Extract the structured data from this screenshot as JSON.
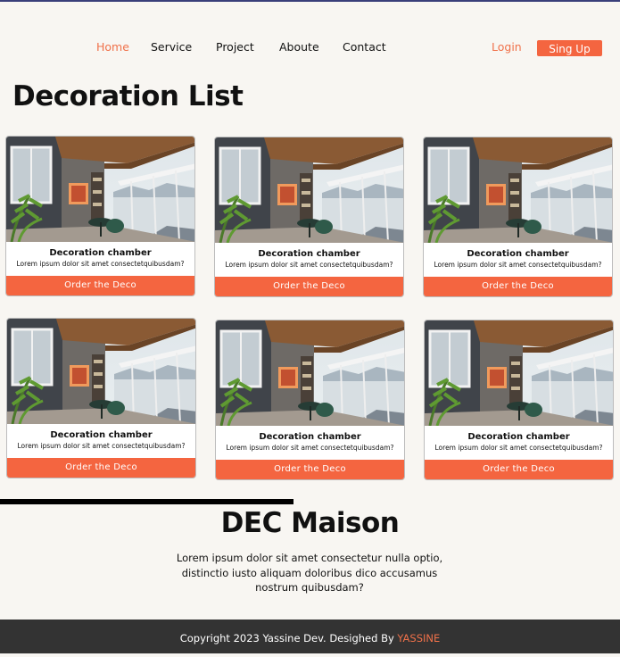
{
  "nav": {
    "items": [
      {
        "label": "Home",
        "active": true
      },
      {
        "label": "Service",
        "active": false
      },
      {
        "label": "Project",
        "active": false
      },
      {
        "label": "Aboute",
        "active": false
      },
      {
        "label": "Contact",
        "active": false
      }
    ],
    "login_label": "Login",
    "signup_label": "Sing Up"
  },
  "page_title": "Decoration List",
  "cards": [
    {
      "title": "Decoration chamber",
      "description": "Lorem ipsum dolor sit amet consectetquibusdam?",
      "button_label": "Order the Deco"
    },
    {
      "title": "Decoration chamber",
      "description": "Lorem ipsum dolor sit amet consectetquibusdam?",
      "button_label": "Order the Deco"
    },
    {
      "title": "Decoration chamber",
      "description": "Lorem ipsum dolor sit amet consectetquibusdam?",
      "button_label": "Order the Deco"
    },
    {
      "title": "Decoration chamber",
      "description": "Lorem ipsum dolor sit amet consectetquibusdam?",
      "button_label": "Order the Deco"
    },
    {
      "title": "Decoration chamber",
      "description": "Lorem ipsum dolor sit amet consectetquibusdam?",
      "button_label": "Order the Deco"
    },
    {
      "title": "Decoration chamber",
      "description": "Lorem ipsum dolor sit amet consectetquibusdam?",
      "button_label": "Order the Deco"
    }
  ],
  "about": {
    "title": "DEC Maison",
    "text": "Lorem ipsum dolor sit amet consectetur  nulla optio, distinctio iusto aliquam doloribus dico accusamus nostrum quibusdam?"
  },
  "footer": {
    "copyright": "Copyright 2023 Yassine Dev. Desighed By ",
    "author": "YASSINE"
  },
  "colors": {
    "accent": "#f46540",
    "background": "#f8f6f2",
    "footer_bg": "#333333"
  }
}
